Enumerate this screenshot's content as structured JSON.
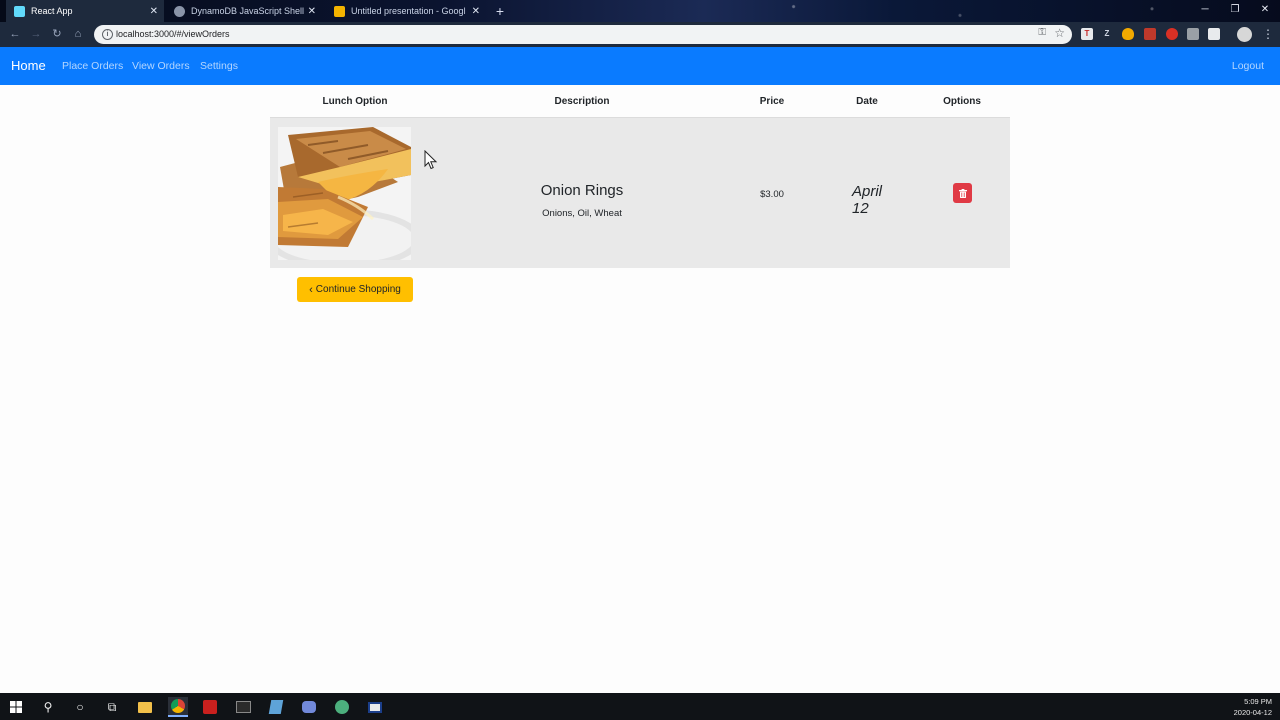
{
  "browser": {
    "tabs": [
      {
        "title": "React App",
        "active": true,
        "icon": "react-icon"
      },
      {
        "title": "DynamoDB JavaScript Shell",
        "active": false,
        "icon": "dynamodb-icon"
      },
      {
        "title": "Untitled presentation - Google S",
        "active": false,
        "icon": "slides-icon"
      }
    ],
    "url": "localhost:3000/#/viewOrders"
  },
  "navbar": {
    "brand": "Home",
    "links": [
      "Place Orders",
      "View Orders",
      "Settings"
    ],
    "logout": "Logout",
    "color": "#0a7bff"
  },
  "table": {
    "headers": [
      "Lunch Option",
      "Description",
      "Price",
      "Date",
      "Options"
    ],
    "rows": [
      {
        "image": "grilled-cheese-sandwich",
        "name": "Onion Rings",
        "ingredients": "Onions, Oil, Wheat",
        "price": "$3.00",
        "date": "April 12",
        "option_icon": "trash-icon"
      }
    ]
  },
  "continue_button": {
    "icon": "chevron-left-icon",
    "label": "Continue Shopping",
    "color": "#ffbf00"
  },
  "taskbar": {
    "clock_time": "5:09 PM",
    "clock_date": "2020-04-12"
  }
}
